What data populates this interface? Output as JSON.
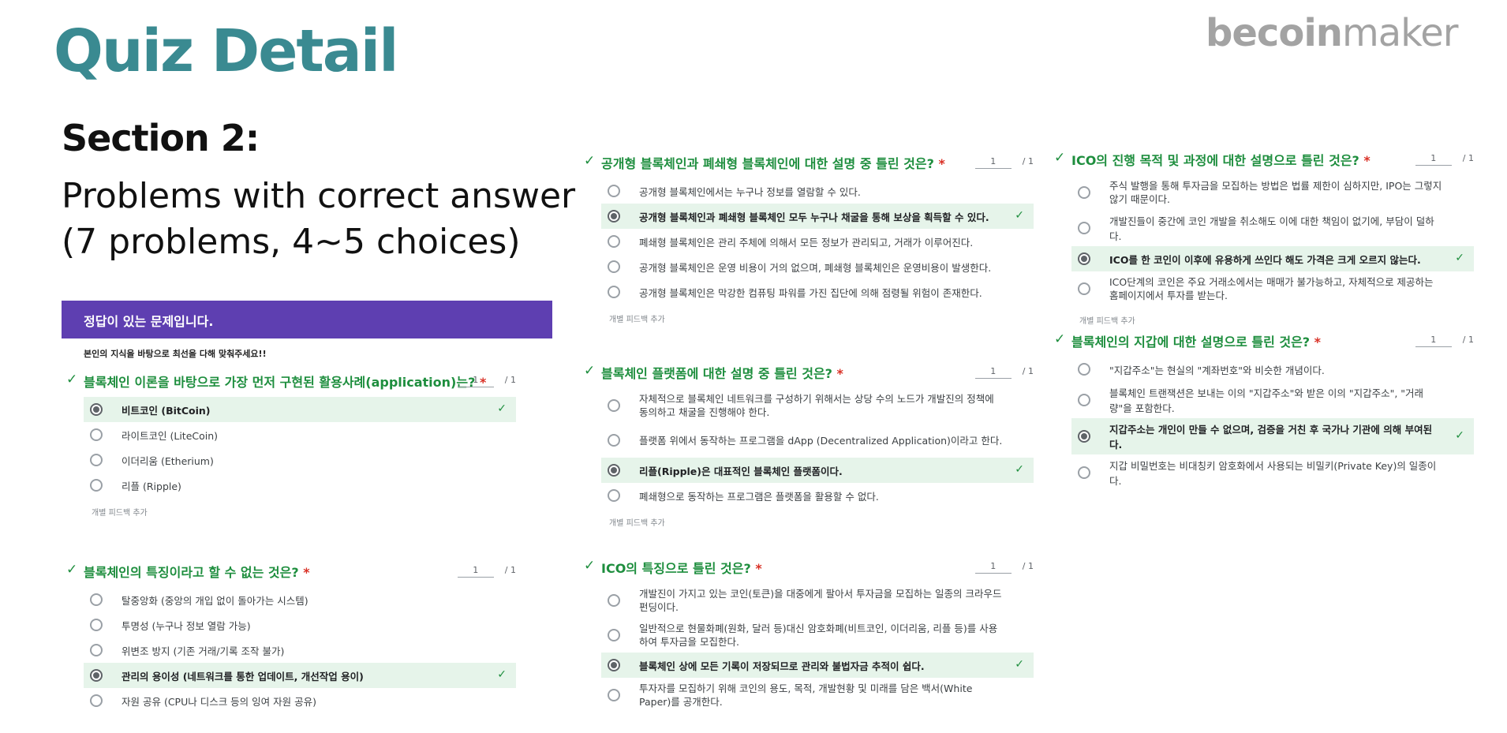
{
  "slide": {
    "title": "Quiz Detail",
    "brand_bold": "becoin",
    "brand_light": "maker",
    "section_heading": "Section 2:",
    "section_desc_line1": "Problems with correct answer",
    "section_desc_line2": "(7 problems, 4~5 choices)"
  },
  "form": {
    "banner": "정답이 있는 문제입니다.",
    "description": "본인의 지식을 바탕으로 최선을 다해 맞춰주세요!!",
    "feedback_label": "개별 피드백 추가",
    "required_mark": "*",
    "check_glyph": "✓",
    "score_value": "1",
    "score_total": "/ 1"
  },
  "questions": [
    {
      "title": "블록체인 이론을 바탕으로 가장 먼저 구현된 활용사례(application)는?",
      "choices": [
        "비트코인 (BitCoin)",
        "라이트코인 (LiteCoin)",
        "이더리움 (Etherium)",
        "리플 (Ripple)"
      ],
      "correct_index": 0
    },
    {
      "title": "블록체인의 특징이라고 할 수 없는 것은?",
      "choices": [
        "탈중앙화 (중앙의 개입 없이 돌아가는 시스템)",
        "투명성 (누구나 정보 열람 가능)",
        "위변조 방지 (기존 거래/기록 조작 불가)",
        "관리의 용이성 (네트워크를 통한 업데이트, 개선작업 용이)",
        "자원 공유 (CPU나 디스크 등의 잉여 자원 공유)"
      ],
      "correct_index": 3
    },
    {
      "title": "공개형 블록체인과 폐쇄형 블록체인에 대한 설명 중 틀린 것은?",
      "choices": [
        "공개형 블록체인에서는 누구나 정보를 열람할 수 있다.",
        "공개형 블록체인과 폐쇄형 블록체인 모두 누구나 채굴을 통해 보상을 획득할 수 있다.",
        "폐쇄형 블록체인은 관리 주체에 의해서 모든 정보가 관리되고, 거래가 이루어진다.",
        "공개형 블록체인은 운영 비용이 거의 없으며, 폐쇄형 블록체인은 운영비용이 발생한다.",
        "공개형 블록체인은 막강한 컴퓨팅 파워를 가진 집단에 의해 점령될 위험이 존재한다."
      ],
      "correct_index": 1
    },
    {
      "title": "블록체인 플랫폼에 대한 설명 중 틀린 것은?",
      "choices": [
        "자체적으로 블록체인 네트워크를 구성하기 위해서는 상당 수의 노드가 개발진의 정책에 동의하고 채굴을 진행해야 한다.",
        "플랫폼 위에서 동작하는 프로그램을 dApp (Decentralized Application)이라고 한다.",
        "리플(Ripple)은 대표적인 블록체인 플랫폼이다.",
        "폐쇄형으로 동작하는 프로그램은 플랫폼을 활용할 수 없다."
      ],
      "correct_index": 2
    },
    {
      "title": "ICO의 특징으로 틀린 것은?",
      "choices": [
        "개발진이 가지고 있는 코인(토큰)을 대중에게 팔아서 투자금을 모집하는 일종의 크라우드 펀딩이다.",
        "일반적으로 현물화폐(원화, 달러 등)대신 암호화폐(비트코인, 이더리움, 리플 등)를 사용하여 투자금을 모집한다.",
        "블록체인 상에 모든 기록이 저장되므로 관리와 불법자금 추적이 쉽다.",
        "투자자를 모집하기 위해 코인의 용도, 목적, 개발현황 및 미래를 담은 백서(White Paper)를 공개한다."
      ],
      "correct_index": 2
    },
    {
      "title": "ICO의 진행 목적 및 과정에 대한 설명으로 틀린 것은?",
      "choices": [
        "주식 발행을 통해 투자금을 모집하는 방법은 법률 제한이 심하지만, IPO는 그렇지 않기 때문이다.",
        "개발진들이 중간에 코인 개발을 취소해도 이에 대한 책임이 없기에, 부담이 덜하다.",
        "ICO를 한 코인이 이후에 유용하게 쓰인다 해도 가격은 크게 오르지 않는다.",
        "ICO단계의 코인은 주요 거래소에서는 매매가 불가능하고, 자체적으로 제공하는 홈페이지에서 투자를 받는다."
      ],
      "correct_index": 2
    },
    {
      "title": "블록체인의 지갑에 대한 설명으로 틀린 것은?",
      "choices": [
        "\"지갑주소\"는 현실의 \"계좌번호\"와 비슷한 개념이다.",
        "블록체인 트랜잭션은 보내는 이의 \"지갑주소\"와 받은 이의 \"지갑주소\", \"거래량\"을 포함한다.",
        "지갑주소는 개인이 만들 수 없으며, 검증을 거친 후 국가나 기관에 의해 부여된다.",
        "지갑 비밀번호는 비대칭키 암호화에서 사용되는 비밀키(Private Key)의 일종이다."
      ],
      "correct_index": 2
    }
  ]
}
